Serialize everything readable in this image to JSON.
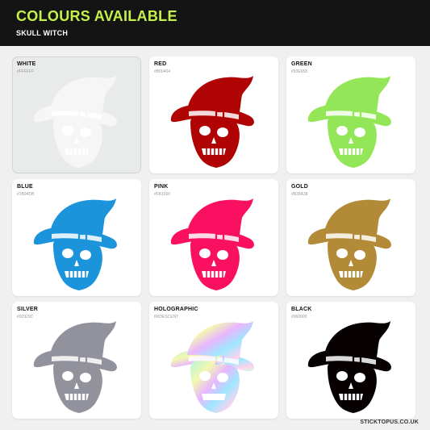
{
  "header": {
    "title": "COLOURS AVAILABLE",
    "subtitle": "SKULL WITCH"
  },
  "colours": [
    {
      "name": "WHITE",
      "code": "#FFFFFF",
      "fill": "#f6f6f6",
      "selected": true
    },
    {
      "name": "RED",
      "code": "#B00404",
      "fill": "#b00404"
    },
    {
      "name": "GREEN",
      "code": "#93E658",
      "fill": "#93e658"
    },
    {
      "name": "BLUE",
      "code": "#1B94DB",
      "fill": "#1b94db"
    },
    {
      "name": "PINK",
      "code": "#FA1060",
      "fill": "#fa1060"
    },
    {
      "name": "GOLD",
      "code": "#B38A38",
      "fill": "#b38a38"
    },
    {
      "name": "SILVER",
      "code": "#92929C",
      "fill": "#92929c"
    },
    {
      "name": "HOLOGRAPHIC",
      "code": "IRIDESCENT",
      "fill": "holo"
    },
    {
      "name": "BLACK",
      "code": "#060000",
      "fill": "#060000"
    }
  ],
  "footer": {
    "site": "STICKTOPUS.CO.UK"
  }
}
